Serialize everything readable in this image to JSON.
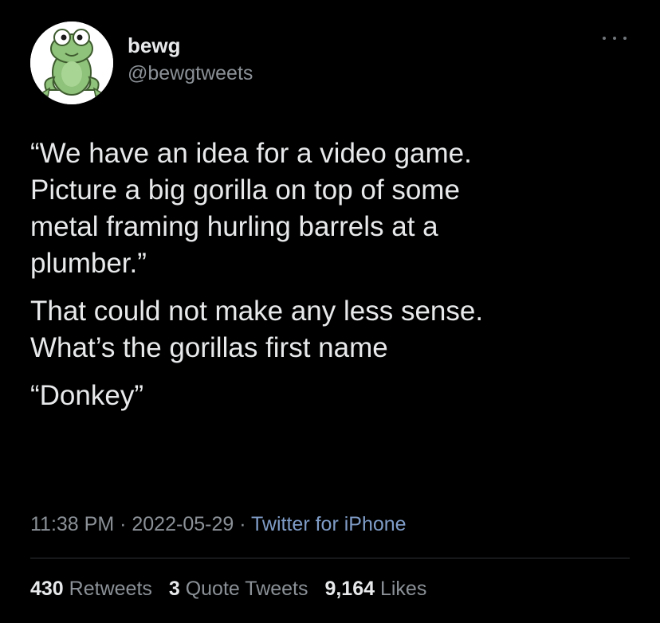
{
  "user": {
    "display_name": "bewg",
    "handle": "@bewgtweets",
    "avatar_icon": "frog-avatar-icon"
  },
  "menu": {
    "icon": "more-options-icon"
  },
  "tweet": {
    "paragraph_1": [
      "“We have an idea for a video game.",
      "Picture a big gorilla on top of some",
      "metal framing hurling barrels at a",
      "plumber.”"
    ],
    "paragraph_2": [
      "That could not make any less sense.",
      "What’s the gorillas first name"
    ],
    "paragraph_3": "“Donkey”"
  },
  "meta": {
    "time": "11:38 PM",
    "separator_1": " · ",
    "date": "2022-05-29",
    "separator_2": " · ",
    "source": "Twitter for iPhone"
  },
  "stats": {
    "retweets_count": "430",
    "retweets_label": "Retweets",
    "quotes_count": "3",
    "quotes_label": "Quote Tweets",
    "likes_count": "9,164",
    "likes_label": "Likes"
  },
  "colors": {
    "background": "#000000",
    "text_primary": "#e7e9ea",
    "text_secondary": "#8b9197",
    "link": "#7f9cc7",
    "divider": "#2f3336",
    "frog_green": "#8fc27a"
  }
}
